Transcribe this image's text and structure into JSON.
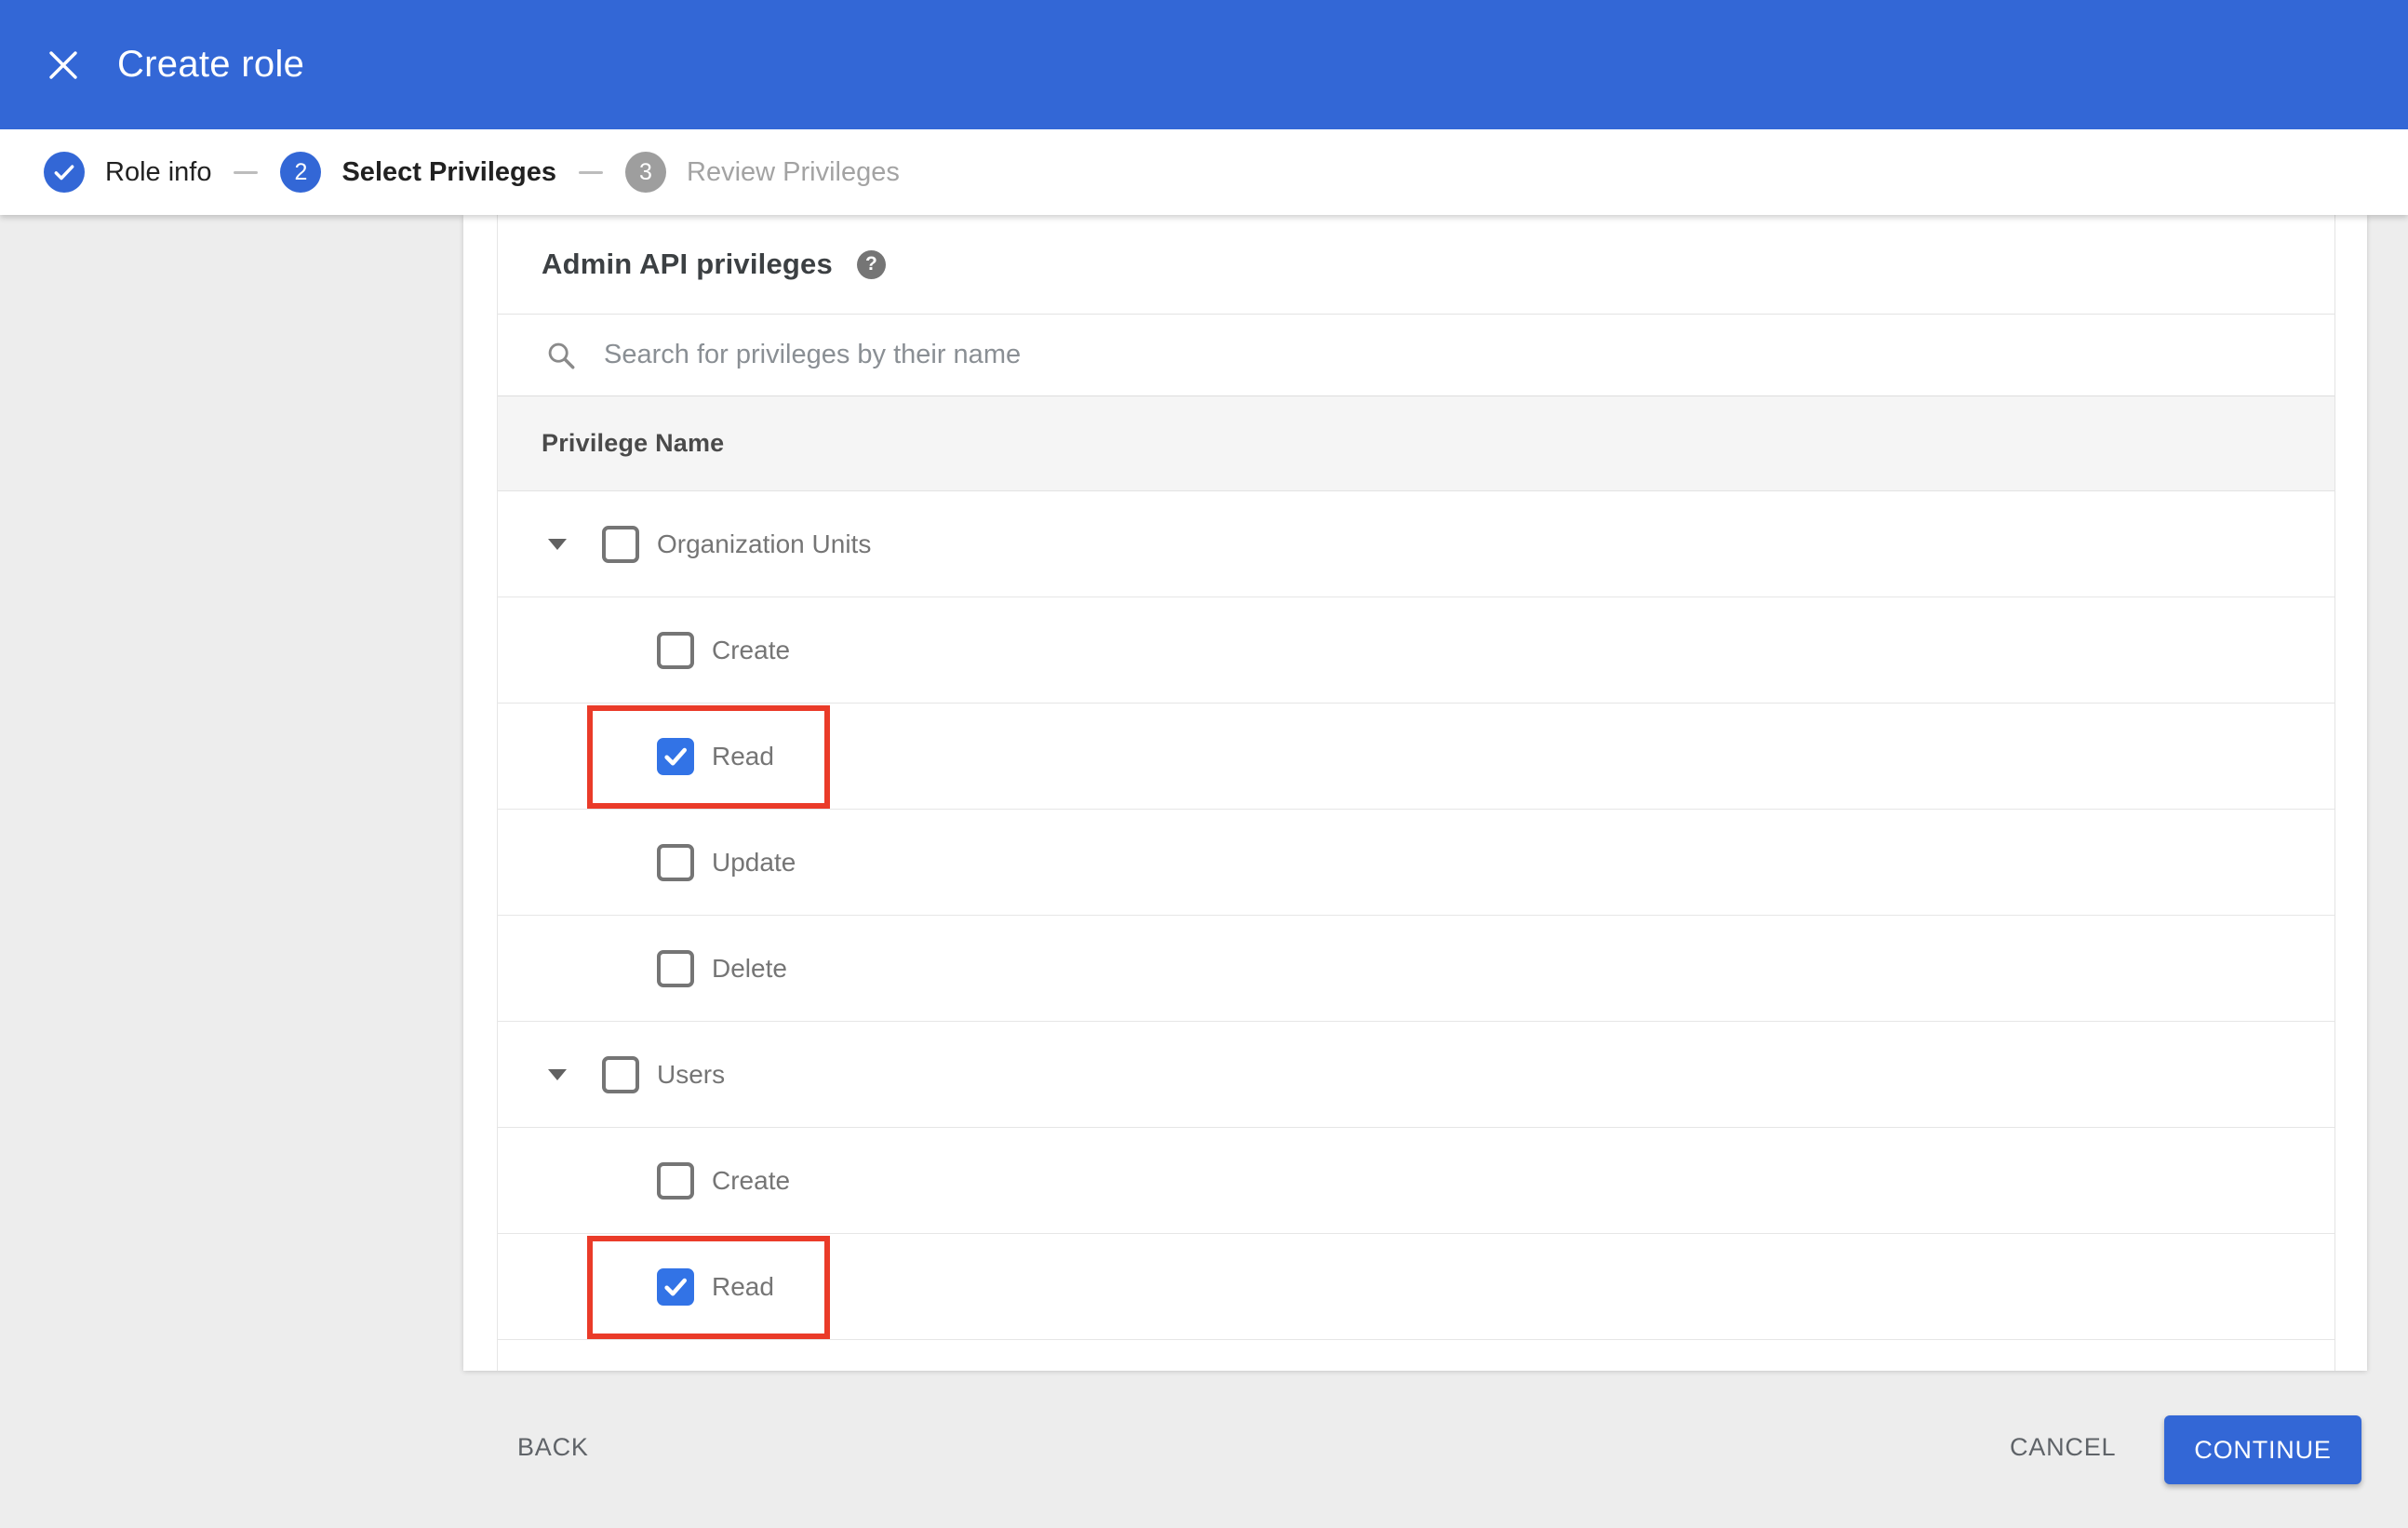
{
  "header": {
    "title": "Create role",
    "close_icon": "x-close-icon"
  },
  "stepper": {
    "steps": [
      {
        "label": "Role info",
        "state": "completed",
        "indicator": "check-icon"
      },
      {
        "label": "Select Privileges",
        "state": "active",
        "indicator": "2"
      },
      {
        "label": "Review Privileges",
        "state": "upcoming",
        "indicator": "3"
      }
    ]
  },
  "privileges_panel": {
    "title": "Admin API privileges",
    "help_icon": "question-mark-icon",
    "search": {
      "placeholder": "Search for privileges by their name",
      "value": "",
      "icon": "search-icon"
    },
    "table": {
      "header": "Privilege Name",
      "rows": [
        {
          "label": "Organization Units",
          "level": 0,
          "expandable": true,
          "expanded": true,
          "checked": false,
          "highlighted": false
        },
        {
          "label": "Create",
          "level": 1,
          "expandable": false,
          "expanded": false,
          "checked": false,
          "highlighted": false
        },
        {
          "label": "Read",
          "level": 1,
          "expandable": false,
          "expanded": false,
          "checked": true,
          "highlighted": true
        },
        {
          "label": "Update",
          "level": 1,
          "expandable": false,
          "expanded": false,
          "checked": false,
          "highlighted": false
        },
        {
          "label": "Delete",
          "level": 1,
          "expandable": false,
          "expanded": false,
          "checked": false,
          "highlighted": false
        },
        {
          "label": "Users",
          "level": 0,
          "expandable": true,
          "expanded": true,
          "checked": false,
          "highlighted": false
        },
        {
          "label": "Create",
          "level": 1,
          "expandable": false,
          "expanded": false,
          "checked": false,
          "highlighted": false
        },
        {
          "label": "Read",
          "level": 1,
          "expandable": false,
          "expanded": false,
          "checked": true,
          "highlighted": true
        }
      ]
    }
  },
  "footer": {
    "back_label": "BACK",
    "cancel_label": "CANCEL",
    "continue_label": "CONTINUE"
  },
  "colors": {
    "brand_blue": "#3367d6",
    "checkbox_blue": "#3273e6",
    "highlight_red": "#ea3b29",
    "inactive_step_gray": "#9e9e9e",
    "page_background": "#ededed"
  }
}
